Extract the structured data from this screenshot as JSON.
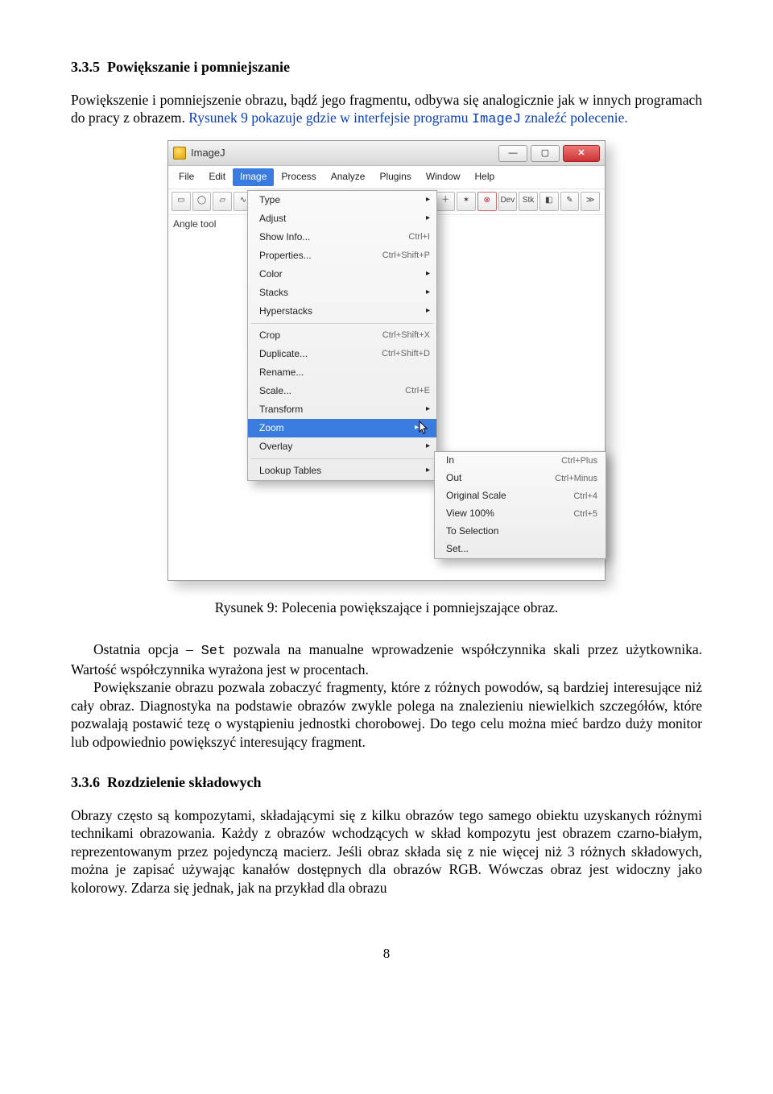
{
  "section_335": {
    "num": "3.3.5",
    "title": "Powiększanie i pomniejszanie"
  },
  "intro1": "Powiększenie i pomniejszenie obrazu, bądź jego fragmentu, odbywa się analogicznie jak w innych programach do pracy z obrazem. ",
  "intro2_a": "Rysunek 9 pokazuje gdzie w interfejsie programu ",
  "intro2_code": "ImageJ",
  "intro2_b": " znaleźć polecenie.",
  "figure_caption": "Rysunek 9: Polecenia powiększające i pomniejszające obraz.",
  "para2a": "Ostatnia opcja – ",
  "para2code": "Set",
  "para2b": " pozwala na manualne wprowadzenie współczynnika skali przez użytkownika. Wartość współczynnika wyrażona jest w procentach.",
  "para3": "Powiększanie obrazu pozwala zobaczyć fragmenty, które z różnych powodów, są bardziej interesujące niż cały obraz. Diagnostyka na podstawie obrazów zwykle polega na znalezieniu niewielkich szczegółów, które pozwalają postawić tezę o wystąpieniu jednostki chorobowej. Do tego celu można mieć bardzo duży monitor lub odpowiednio powiększyć interesujący fragment.",
  "section_336": {
    "num": "3.3.6",
    "title": "Rozdzielenie składowych"
  },
  "para4": "Obrazy często są kompozytami, składającymi się z kilku obrazów tego samego obiektu uzyskanych różnymi technikami obrazowania. Każdy z obrazów wchodzących w skład kompozytu jest obrazem czarno-białym, reprezentowanym przez pojedynczą macierz. Jeśli obraz składa się z nie więcej niż 3 różnych składowych, można je zapisać używając kanałów dostępnych dla obrazów RGB. Wówczas obraz jest widoczny jako kolorowy. Zdarza się jednak, jak na przykład dla obrazu",
  "page_number": "8",
  "imagej": {
    "title": "ImageJ",
    "menubar": [
      "File",
      "Edit",
      "Image",
      "Process",
      "Analyze",
      "Plugins",
      "Window",
      "Help"
    ],
    "toolbar_badges": [
      "Dev",
      "Stk"
    ],
    "status": "Angle tool",
    "image_menu": [
      {
        "label": "Type",
        "arrow": true
      },
      {
        "label": "Adjust",
        "arrow": true
      },
      {
        "label": "Show Info...",
        "shortcut": "Ctrl+I"
      },
      {
        "label": "Properties...",
        "shortcut": "Ctrl+Shift+P"
      },
      {
        "label": "Color",
        "arrow": true
      },
      {
        "label": "Stacks",
        "arrow": true
      },
      {
        "label": "Hyperstacks",
        "arrow": true
      },
      {
        "sep": true
      },
      {
        "label": "Crop",
        "shortcut": "Ctrl+Shift+X"
      },
      {
        "label": "Duplicate...",
        "shortcut": "Ctrl+Shift+D"
      },
      {
        "label": "Rename..."
      },
      {
        "label": "Scale...",
        "shortcut": "Ctrl+E"
      },
      {
        "label": "Transform",
        "arrow": true
      },
      {
        "label": "Zoom",
        "arrow": true,
        "selected": true
      },
      {
        "label": "Overlay",
        "arrow": true
      },
      {
        "sep": true
      },
      {
        "label": "Lookup Tables",
        "arrow": true
      }
    ],
    "zoom_submenu": [
      {
        "label": "In",
        "shortcut": "Ctrl+Plus"
      },
      {
        "label": "Out",
        "shortcut": "Ctrl+Minus"
      },
      {
        "label": "Original Scale",
        "shortcut": "Ctrl+4"
      },
      {
        "label": "View 100%",
        "shortcut": "Ctrl+5"
      },
      {
        "label": "To Selection"
      },
      {
        "label": "Set..."
      }
    ]
  }
}
